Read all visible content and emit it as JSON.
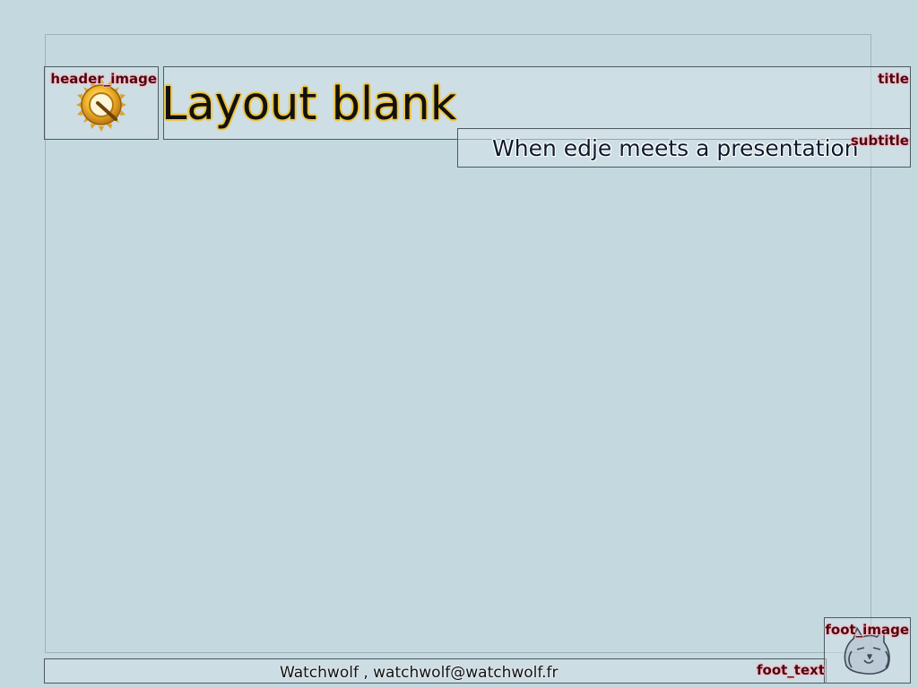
{
  "slide": {
    "title": "Layout blank",
    "subtitle": "When edje meets a presentation",
    "foot_text": "Watchwolf , watchwolf@watchwolf.fr"
  },
  "region_labels": {
    "header_image": "header_image",
    "title": "title",
    "subtitle": "subtitle",
    "foot_text": "foot_text",
    "foot_image": "foot_image"
  },
  "icons": {
    "header_logo": "enlightenment-logo-icon",
    "foot_logo": "wolf-head-icon"
  },
  "colors": {
    "background": "#c4d8df",
    "label_text": "#4a0a12",
    "label_glow": "#ffb6c1",
    "title_outline": "#f1c232",
    "logo_gold": "#f3b72a"
  }
}
